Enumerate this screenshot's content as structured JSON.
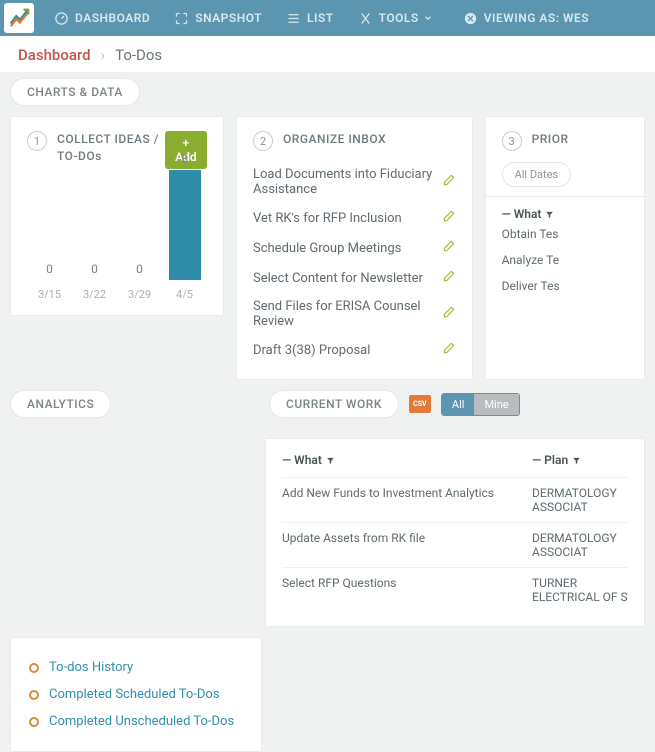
{
  "nav": {
    "dashboard": "DASHBOARD",
    "snapshot": "SNAPSHOT",
    "list": "LIST",
    "tools": "TOOLS",
    "viewing": "VIEWING AS: WES"
  },
  "crumbs": {
    "dash": "Dashboard",
    "current": "To-Dos"
  },
  "sections": {
    "charts": "CHARTS & DATA",
    "analytics": "ANALYTICS",
    "current_work": "CURRENT WORK"
  },
  "step1": {
    "num": "1",
    "label": "COLLECT IDEAS / TO-DOs",
    "add": "+ Add"
  },
  "step2": {
    "num": "2",
    "label": "ORGANIZE INBOX"
  },
  "step3": {
    "num": "3",
    "label": "PRIOR",
    "all_dates": "All Dates",
    "what": "— What"
  },
  "inbox": [
    "Load Documents into Fiduciary Assistance",
    "Vet RK's for RFP Inclusion",
    "Schedule Group Meetings",
    "Select Content for Newsletter",
    "Send Files for ERISA Counsel Review",
    "Draft 3(38) Proposal"
  ],
  "prior_rows": [
    "Obtain Tes",
    "Analyze Te",
    "Deliver Tes"
  ],
  "analytics": [
    "To-dos History",
    "Completed Scheduled To-Dos",
    "Completed Unscheduled To-Dos"
  ],
  "cw": {
    "all": "All",
    "mine": "Mine",
    "what": "— What",
    "plan": "— Plan"
  },
  "cw_rows": [
    {
      "what": "Add New Funds to Investment Analytics",
      "plan": "DERMATOLOGY ASSOCIAT"
    },
    {
      "what": "Update Assets from RK file",
      "plan": "DERMATOLOGY ASSOCIAT"
    },
    {
      "what": "Select RFP Questions",
      "plan": "TURNER ELECTRICAL OF S"
    }
  ],
  "chart_data": {
    "type": "bar",
    "categories": [
      "3/15",
      "3/22",
      "3/29",
      "4/5"
    ],
    "values": [
      0,
      0,
      0,
      8
    ],
    "ylim": [
      0,
      8
    ]
  }
}
